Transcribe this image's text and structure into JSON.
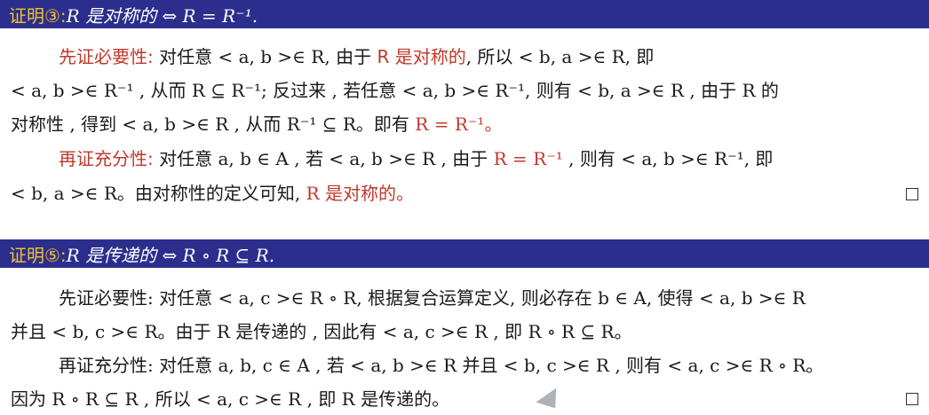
{
  "proof3": {
    "label": "证明③:",
    "title_math": "R 是对称的 ⇔ R = R⁻¹.",
    "l1_head": "先证必要性:",
    "l1_a": "对任意 < a, b >∈ R, 由于",
    "l1_red": "R 是对称的",
    "l1_b": ", 所以 < b, a >∈ R, 即",
    "l2": "< a, b >∈ R⁻¹ , 从而 R ⊆ R⁻¹; 反过来 , 若任意 < a, b >∈ R⁻¹, 则有 < b, a >∈ R , 由于 R 的",
    "l3_a": "对称性 , 得到 < a, b >∈ R , 从而 R⁻¹ ⊆ R。即有",
    "l3_red": "R = R⁻¹。",
    "l4_head": "再证充分性:",
    "l4_a": "对任意 a, b ∈ A , 若 < a, b >∈ R , 由于",
    "l4_red": "R = R⁻¹",
    "l4_b": ", 则有 < a, b >∈ R⁻¹, 即",
    "l5_a": "< b, a >∈ R。由对称性的定义可知,",
    "l5_red": "R 是对称的。"
  },
  "proof5": {
    "label": "证明⑤:",
    "title_math": "R 是传递的 ⇔ R ∘ R ⊆ R.",
    "l1": "先证必要性: 对任意 < a, c >∈ R ∘ R, 根据复合运算定义, 则必存在 b ∈ A, 使得 < a, b >∈ R",
    "l2": "并且 < b, c >∈ R。由于 R 是传递的 , 因此有 < a, c >∈ R , 即 R ∘ R ⊆ R。",
    "l3": "再证充分性: 对任意 a, b, c ∈ A , 若 < a, b >∈ R 并且 < b, c >∈ R , 则有 < a, c >∈ R ∘ R。",
    "l4": "因为 R ∘ R ⊆ R , 所以 < a, c >∈ R , 即 R 是传递的。"
  },
  "colors": {
    "banner": "#2b2e8c",
    "label": "#f2c230",
    "highlight": "#c0392b"
  }
}
